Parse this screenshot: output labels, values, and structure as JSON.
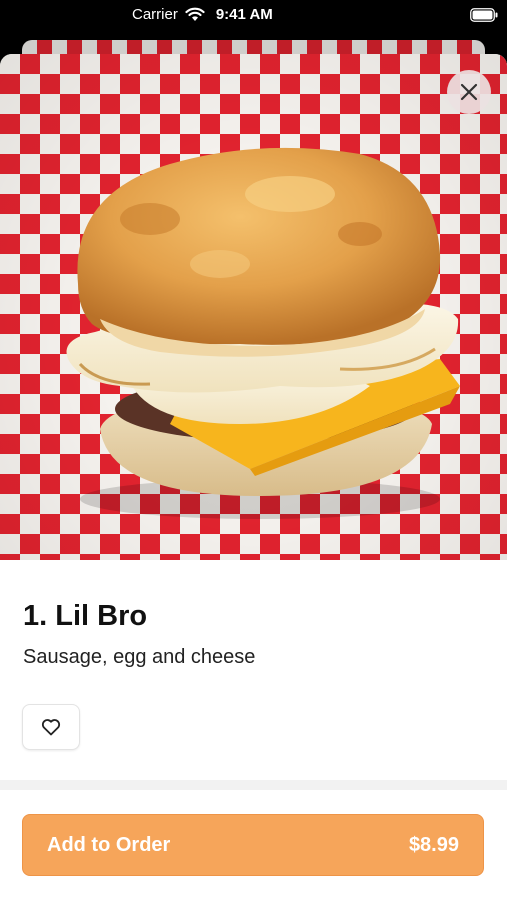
{
  "status_bar": {
    "carrier": "Carrier",
    "time": "9:41 AM"
  },
  "item": {
    "title": "1. Lil Bro",
    "description": "Sausage, egg and cheese",
    "image_icon": "breakfast-sandwich-photo"
  },
  "actions": {
    "close_icon": "close-icon",
    "favorite_icon": "heart-icon",
    "add_label": "Add to Order",
    "price": "$8.99"
  },
  "colors": {
    "accent": "#f6a55a",
    "checker_red": "#e2232f"
  }
}
